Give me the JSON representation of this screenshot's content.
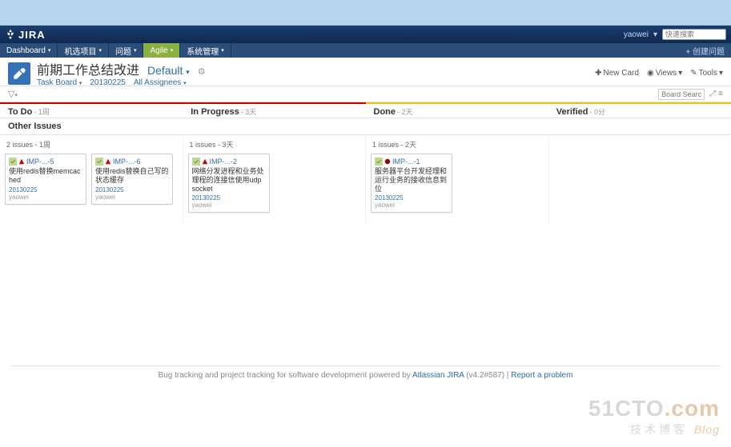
{
  "header": {
    "logo_text": "JIRA",
    "username": "yaowei",
    "search_placeholder": "快速搜索"
  },
  "nav": {
    "items": [
      {
        "label": "Dashboard"
      },
      {
        "label": "机选项目"
      },
      {
        "label": "问题"
      },
      {
        "label": "Agile"
      },
      {
        "label": "系统管理"
      }
    ],
    "create_label": "+ 创建问题"
  },
  "page": {
    "title": "前期工作总结改进",
    "default_label": "Default",
    "sub": {
      "task_board": "Task Board",
      "sprint": "20130225",
      "assignees": "All Assignees"
    },
    "actions": {
      "new_card": "New Card",
      "views": "Views",
      "tools": "Tools"
    },
    "board_search_placeholder": "Board Search"
  },
  "columns": [
    {
      "name": "To Do",
      "sub": "- 1周"
    },
    {
      "name": "In Progress",
      "sub": "- 3天"
    },
    {
      "name": "Done",
      "sub": "- 2天"
    },
    {
      "name": "Verified",
      "sub": "- 0分"
    }
  ],
  "swimlane": {
    "label": "Other Issues",
    "cols": [
      {
        "count": "2 issues - 1周",
        "cards": [
          {
            "key": "IMP-...-5",
            "status": "open",
            "summary": "使用redis替换memcached",
            "version": "20130225",
            "assignee": "yaowei"
          },
          {
            "key": "IMP-...-6",
            "status": "open",
            "summary": "使用redis替换自己写的状态缓存",
            "version": "20130225",
            "assignee": "yaowei"
          }
        ]
      },
      {
        "count": "1 issues - 3天",
        "cards": [
          {
            "key": "IMP-...-2",
            "status": "open",
            "summary": "网络分发进程和业务处理程的连接信使用udp socket",
            "version": "20130225",
            "assignee": "yaowei"
          }
        ]
      },
      {
        "count": "1 issues - 2天",
        "cards": [
          {
            "key": "IMP-...-1",
            "status": "done",
            "summary": "服务器平台开发经理和运行业务的接收信息到位",
            "version": "20130225",
            "assignee": "yaowei"
          }
        ]
      },
      {
        "count": "",
        "cards": []
      }
    ]
  },
  "footer": {
    "text_pre": "Bug tracking and project tracking for software development powered by ",
    "link1": "Atlassian JIRA",
    "version": " (v4.2#587) | ",
    "link2": "Report a problem"
  },
  "watermark": {
    "line1_a": "51CTO",
    "line1_b": ".com",
    "line2_a": "技术博客",
    "line2_b": "Blog"
  }
}
